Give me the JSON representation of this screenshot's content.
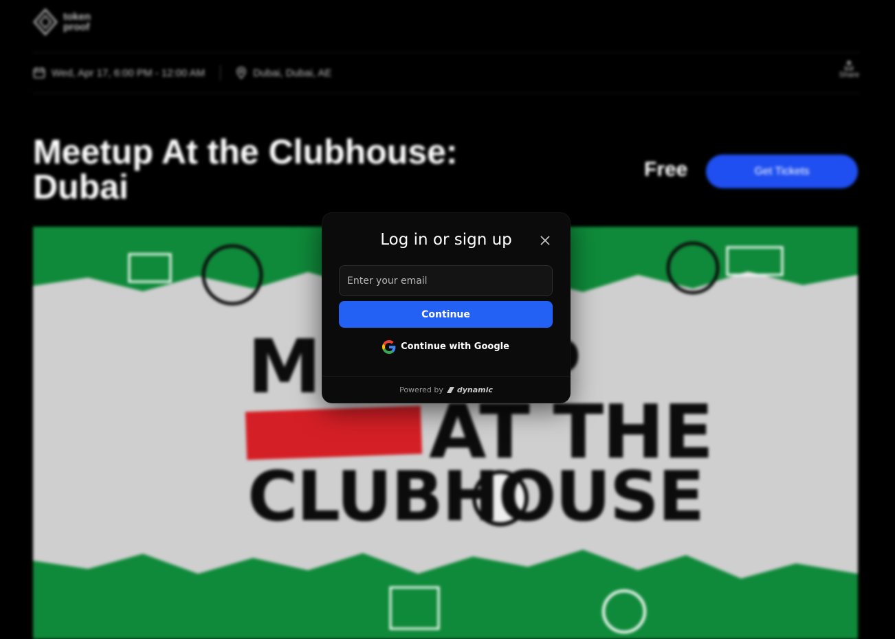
{
  "header": {
    "logo_text_line1": "token",
    "logo_text_line2": "proof"
  },
  "event_info": {
    "datetime": "Wed, Apr 17, 6:00 PM - 12:00 AM",
    "location": "Dubai, Dubai, AE",
    "share_label": "Share"
  },
  "event": {
    "title": "Meetup At the Clubhouse: Dubai",
    "price": "Free",
    "cta_label": "Get Tickets"
  },
  "poster": {
    "line1": "MEETUP",
    "line2": "AT THE",
    "line3": "CLUBHOUSE",
    "colors": {
      "green": "#0f8a3a",
      "red": "#d51f26",
      "paper": "#cfcfcf",
      "ink": "#0c0c0c"
    }
  },
  "login_modal": {
    "title": "Log in or sign up",
    "email_placeholder": "Enter your email",
    "email_value": "",
    "continue_label": "Continue",
    "google_label": "Continue with Google",
    "powered_by": "Powered by",
    "brand": "dynamic"
  },
  "colors": {
    "accent": "#2361f5",
    "cta": "#1f4ff0",
    "background": "#000000",
    "modal_bg": "#0b0b0b"
  }
}
